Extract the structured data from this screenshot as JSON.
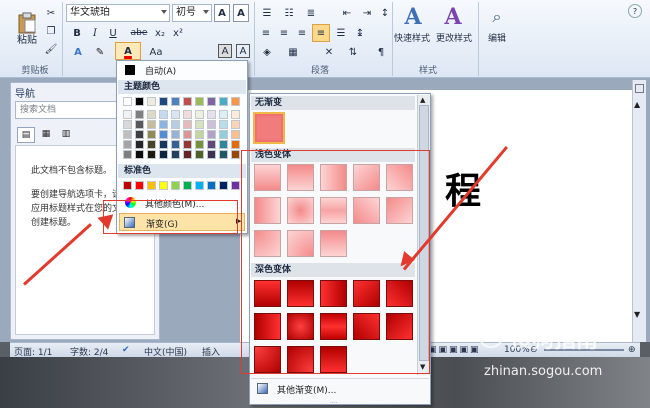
{
  "ribbon": {
    "paste_label": "粘贴",
    "clipboard_label": "剪贴板",
    "font_name": "华文琥珀",
    "font_size": "初号",
    "font_a_button": "A",
    "bold": "B",
    "italic": "I",
    "underline": "U",
    "strike": "abe",
    "subscript": "x₂",
    "superscript": "x²",
    "font_color_a": "A",
    "change_case": "Aa",
    "char_border_a": "A",
    "char_shade_a": "A",
    "paragraph_label": "段落",
    "styles_label": "样式",
    "quick_styles": "快速样式",
    "change_styles": "更改样式",
    "editing": "编辑"
  },
  "nav": {
    "title": "导航",
    "search_placeholder": "搜索文档",
    "text1": "此文档不包含标题。",
    "text2": "要创建导航选项卡，请",
    "text3": "应用标题样式在您的文",
    "text4": "创建标题。"
  },
  "document": {
    "heading_fragment": "程"
  },
  "status": {
    "page": "页面: 1/1",
    "words": "字数: 2/4",
    "lang": "中文(中国)",
    "insert": "插入",
    "zoom": "100%"
  },
  "color_menu": {
    "auto": "自动(A)",
    "theme_colors": "主题颜色",
    "standard_colors": "标准色",
    "more_colors": "其他颜色(M)...",
    "gradient": "渐变(G)",
    "theme_top": [
      "#ffffff",
      "#000000",
      "#eeece1",
      "#1f497d",
      "#4f81bd",
      "#c0504d",
      "#9bbb59",
      "#8064a2",
      "#4bacc6",
      "#f79646"
    ],
    "theme_cols": [
      [
        "#f2f2f2",
        "#d8d8d8",
        "#bfbfbf",
        "#a5a5a5",
        "#7f7f7f"
      ],
      [
        "#7f7f7f",
        "#595959",
        "#3f3f3f",
        "#262626",
        "#0c0c0c"
      ],
      [
        "#ddd9c3",
        "#c4bd97",
        "#938953",
        "#494429",
        "#1d1b10"
      ],
      [
        "#c6d9f0",
        "#8db3e2",
        "#548dd4",
        "#17365d",
        "#0f243e"
      ],
      [
        "#dbe5f1",
        "#b8cce4",
        "#95b3d7",
        "#366092",
        "#244061"
      ],
      [
        "#f2dcdb",
        "#e5b9b7",
        "#d99694",
        "#953734",
        "#632423"
      ],
      [
        "#ebf1dd",
        "#d7e3bc",
        "#c3d69b",
        "#76923c",
        "#4f6128"
      ],
      [
        "#e5e0ec",
        "#ccc1d9",
        "#b2a2c7",
        "#5f497a",
        "#3f3151"
      ],
      [
        "#dbeef3",
        "#b7dde8",
        "#92cddc",
        "#31859b",
        "#205867"
      ],
      [
        "#fdeada",
        "#fbd5b5",
        "#fac08f",
        "#e36c09",
        "#974806"
      ]
    ],
    "standard": [
      "#c00000",
      "#ff0000",
      "#ffc000",
      "#ffff00",
      "#92d050",
      "#00b050",
      "#00b0f0",
      "#0070c0",
      "#002060",
      "#7030a0"
    ]
  },
  "gradient_menu": {
    "no_gradient": "无渐变",
    "light_variants": "浅色变体",
    "dark_variants": "深色变体",
    "more_gradients": "其他渐变(M)..."
  },
  "watermark": {
    "brand": "搜狗指南",
    "url": "zhinan.sogou.com"
  },
  "colors": {
    "highlight_red": "#e23a2c",
    "light_red": "#f7a3a3",
    "dark_red": "#d40000"
  }
}
